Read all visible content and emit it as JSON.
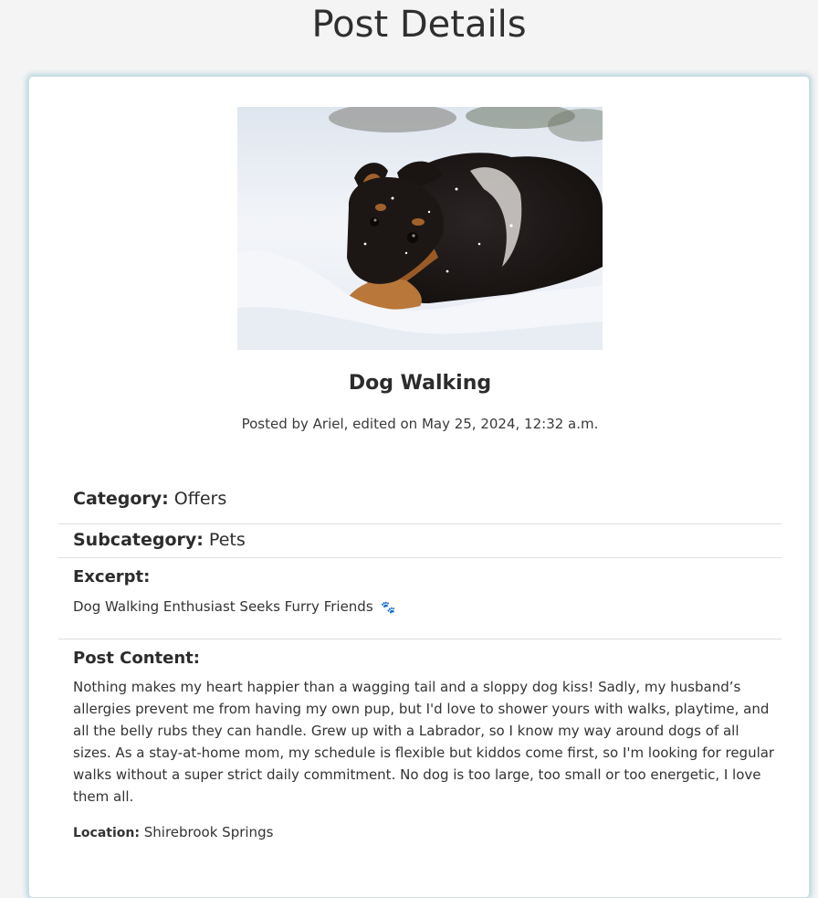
{
  "page": {
    "title": "Post Details"
  },
  "post": {
    "image_icon": "dog-in-snow-photo",
    "title": "Dog Walking",
    "meta": "Posted by Ariel, edited on May 25, 2024, 12:32 a.m.",
    "category_label": "Category:",
    "category_value": "Offers",
    "subcategory_label": "Subcategory:",
    "subcategory_value": "Pets",
    "excerpt_label": "Excerpt:",
    "excerpt_text": "Dog Walking Enthusiast Seeks Furry Friends",
    "excerpt_icon": "paw-prints-icon",
    "excerpt_emoji": "🐾",
    "content_label": "Post Content:",
    "content_text": "Nothing makes my heart happier than a wagging tail and a sloppy dog kiss! Sadly, my husband’s allergies prevent me from having my own pup, but I'd love to shower yours with walks, playtime, and all the belly rubs they can handle. Grew up with a Labrador, so I know my way around dogs of all sizes. As a stay-at-home mom, my schedule is flexible but kiddos come first, so I'm looking for regular walks without a super strict daily commitment. No dog is too large, too small or too energetic, I love them all.",
    "location_label": "Location:",
    "location_value": "Shirebrook Springs"
  },
  "colors": {
    "background": "#f4f4f4",
    "card": "#ffffff",
    "card_glow": "#6eaac3",
    "text": "#2c2c2c",
    "divider": "#dedede"
  }
}
